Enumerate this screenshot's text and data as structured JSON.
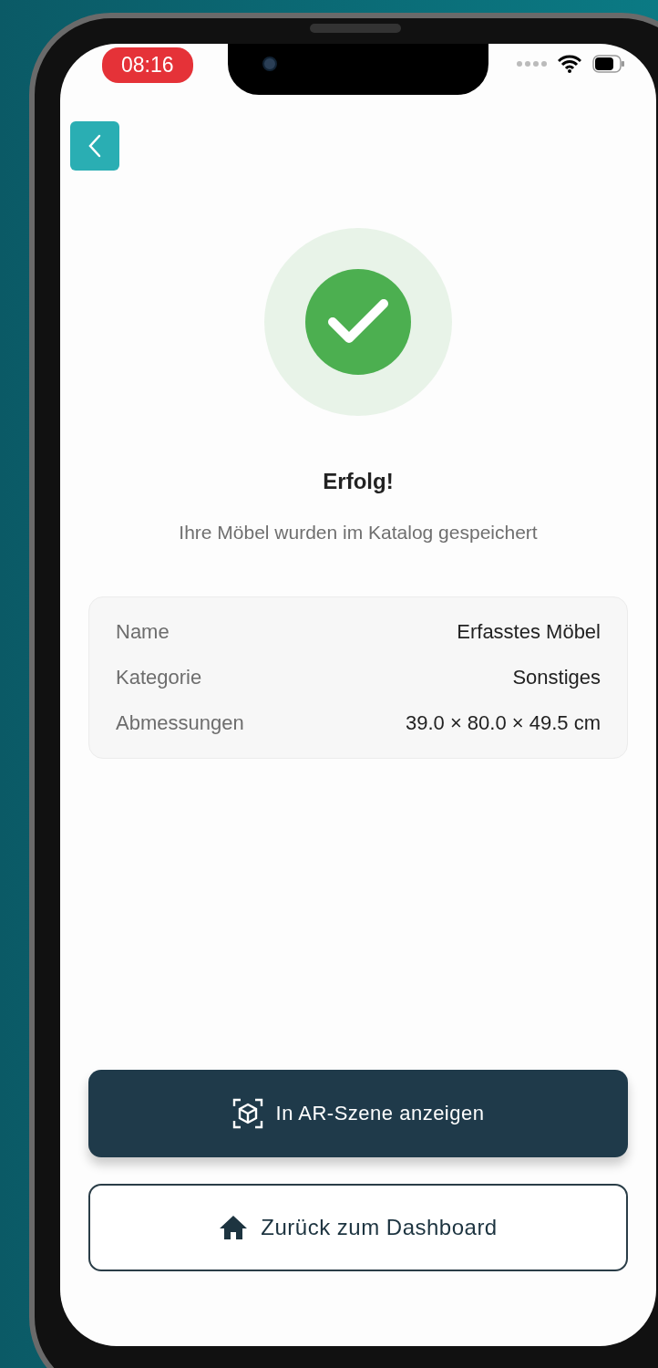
{
  "status_bar": {
    "time": "08:16"
  },
  "success": {
    "title": "Erfolg!",
    "message": "Ihre Möbel wurden im Katalog gespeichert"
  },
  "details": [
    {
      "label": "Name",
      "value": "Erfasstes Möbel"
    },
    {
      "label": "Kategorie",
      "value": "Sonstiges"
    },
    {
      "label": "Abmessungen",
      "value": "39.0 × 80.0 × 49.5 cm"
    }
  ],
  "buttons": [
    {
      "kind": "primary",
      "label": "In AR-Szene anzeigen"
    },
    {
      "kind": "secondary",
      "label": "Zurück zum Dashboard"
    }
  ]
}
